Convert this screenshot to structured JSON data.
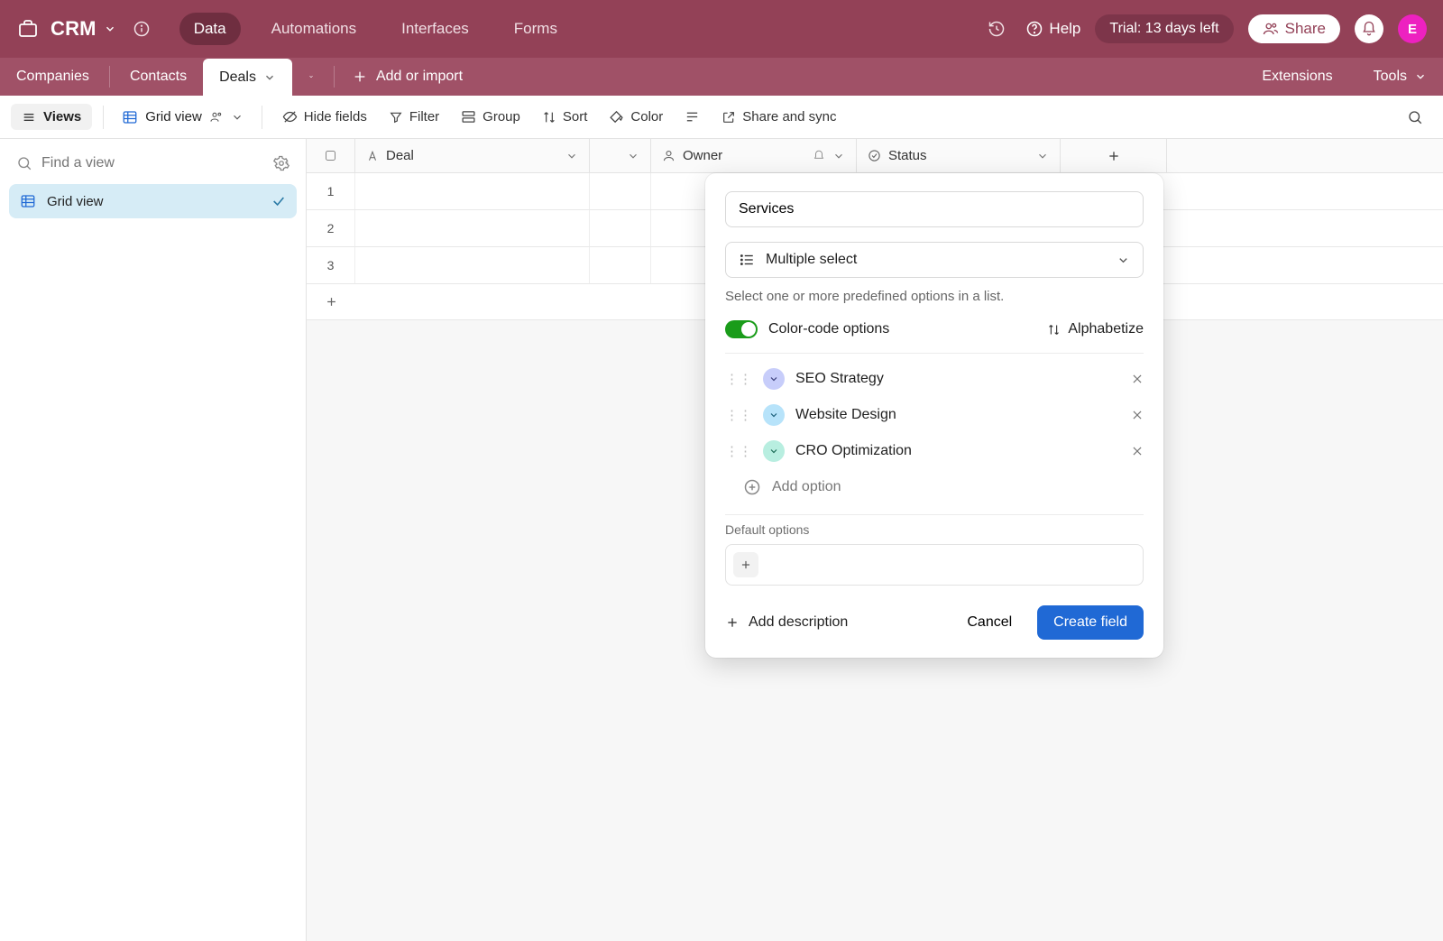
{
  "header": {
    "workspace_name": "CRM",
    "nav": {
      "data": "Data",
      "automations": "Automations",
      "interfaces": "Interfaces",
      "forms": "Forms"
    },
    "help": "Help",
    "trial": "Trial: 13 days left",
    "share": "Share",
    "avatar_initial": "E"
  },
  "tabs": {
    "companies": "Companies",
    "contacts": "Contacts",
    "deals": "Deals",
    "add_or_import": "Add or import",
    "extensions": "Extensions",
    "tools": "Tools"
  },
  "toolbar": {
    "views": "Views",
    "gridview": "Grid view",
    "hide_fields": "Hide fields",
    "filter": "Filter",
    "group": "Group",
    "sort": "Sort",
    "color": "Color",
    "share_sync": "Share and sync"
  },
  "sidebar": {
    "find_placeholder": "Find a view",
    "views": [
      {
        "name": "Grid view"
      }
    ]
  },
  "grid": {
    "columns": {
      "deal": "Deal",
      "owner": "Owner",
      "status": "Status"
    },
    "rows": [
      {
        "num": "1"
      },
      {
        "num": "2"
      },
      {
        "num": "3"
      }
    ]
  },
  "popover": {
    "field_name": "Services",
    "type_label": "Multiple select",
    "type_desc": "Select one or more predefined options in a list.",
    "color_code_label": "Color-code options",
    "alphabetize": "Alphabetize",
    "options": [
      {
        "name": "SEO Strategy",
        "color": "blue"
      },
      {
        "name": "Website Design",
        "color": "sky"
      },
      {
        "name": "CRO Optimization",
        "color": "mint"
      }
    ],
    "add_option": "Add option",
    "default_label": "Default options",
    "add_description": "Add description",
    "cancel": "Cancel",
    "create": "Create field"
  }
}
